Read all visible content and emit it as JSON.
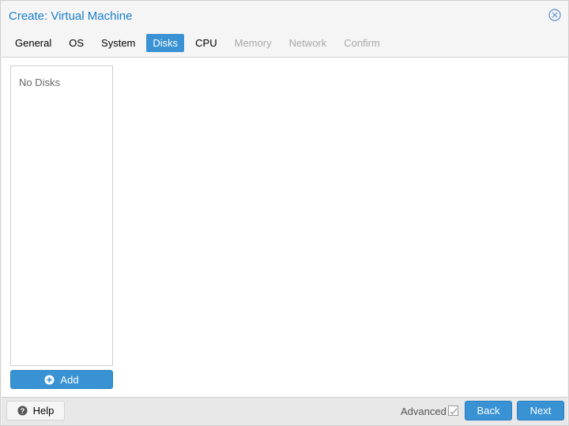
{
  "window": {
    "title": "Create: Virtual Machine"
  },
  "tabs": [
    {
      "label": "General",
      "state": "normal"
    },
    {
      "label": "OS",
      "state": "normal"
    },
    {
      "label": "System",
      "state": "normal"
    },
    {
      "label": "Disks",
      "state": "active"
    },
    {
      "label": "CPU",
      "state": "normal"
    },
    {
      "label": "Memory",
      "state": "disabled"
    },
    {
      "label": "Network",
      "state": "disabled"
    },
    {
      "label": "Confirm",
      "state": "disabled"
    }
  ],
  "disks": {
    "empty_text": "No Disks",
    "add_label": "Add"
  },
  "footer": {
    "help_label": "Help",
    "advanced_label": "Advanced",
    "advanced_checked": true,
    "back_label": "Back",
    "next_label": "Next"
  },
  "icons": {
    "close": "close-circle-icon",
    "add": "plus-circle-icon",
    "help": "question-circle-icon",
    "check": "check-icon"
  },
  "colors": {
    "accent": "#3892d4",
    "title": "#157fcc"
  }
}
